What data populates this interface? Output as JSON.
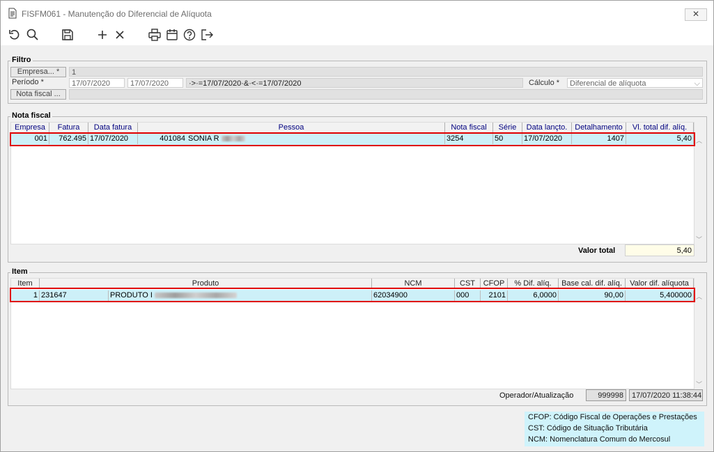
{
  "window": {
    "title": "FISFM061 - Manutenção do Diferencial de Alíquota",
    "close_glyph": "✕"
  },
  "toolbar": {
    "icons": [
      "undo-icon",
      "search-icon",
      "save-icon",
      "add-icon",
      "cancel-icon",
      "print-icon",
      "calendar-icon",
      "help-icon",
      "exit-icon"
    ]
  },
  "filtro": {
    "legend": "Filtro",
    "empresa_button": "Empresa... *",
    "empresa_value": "1",
    "periodo_label": "Período *",
    "periodo_start": "17/07/2020",
    "periodo_end": "17/07/2020",
    "periodo_expr": "·>·=17/07/2020·&·<·=17/07/2020",
    "calculo_label": "Cálculo *",
    "calculo_value": "Diferencial de alíquota",
    "nota_button": "Nota fiscal ...",
    "nota_value": ""
  },
  "nota_fiscal": {
    "legend": "Nota fiscal",
    "columns": [
      "Empresa",
      "Fatura",
      "Data fatura",
      "Pessoa",
      "Nota fiscal",
      "Série",
      "Data lançto.",
      "Detalhamento",
      "Vl. total dif. alíq."
    ],
    "row": {
      "empresa": "001",
      "fatura": "762.495",
      "data_fatura": "17/07/2020",
      "pessoa_code": "401084",
      "pessoa_name": "SONIA R",
      "nota_fiscal": "3254",
      "serie": "50",
      "data_lancto": "17/07/2020",
      "detalhamento": "1407",
      "vl_total": "5,40"
    },
    "valor_total_label": "Valor total",
    "valor_total_value": "5,40"
  },
  "item": {
    "legend": "Item",
    "columns": [
      "Item",
      "Produto",
      "NCM",
      "CST",
      "CFOP",
      "% Dif. alíq.",
      "Base cal. dif. alíq.",
      "Valor dif. alíquota"
    ],
    "row": {
      "item": "1",
      "produto_code": "231647",
      "produto_desc": "PRODUTO I",
      "ncm": "62034900",
      "cst": "000",
      "cfop": "2101",
      "pct_dif": "6,0000",
      "base_cal": "90,00",
      "valor_dif": "5,400000"
    },
    "operador_label": "Operador/Atualização",
    "operador_value": "999998",
    "atualizacao_value": "17/07/2020 11:38:44"
  },
  "legend_info": {
    "cfop": "CFOP: Código Fiscal de Operações e Prestações",
    "cst": "CST: Código de Situação Tributária",
    "ncm": "NCM: Nomenclatura Comum do Mercosul"
  }
}
